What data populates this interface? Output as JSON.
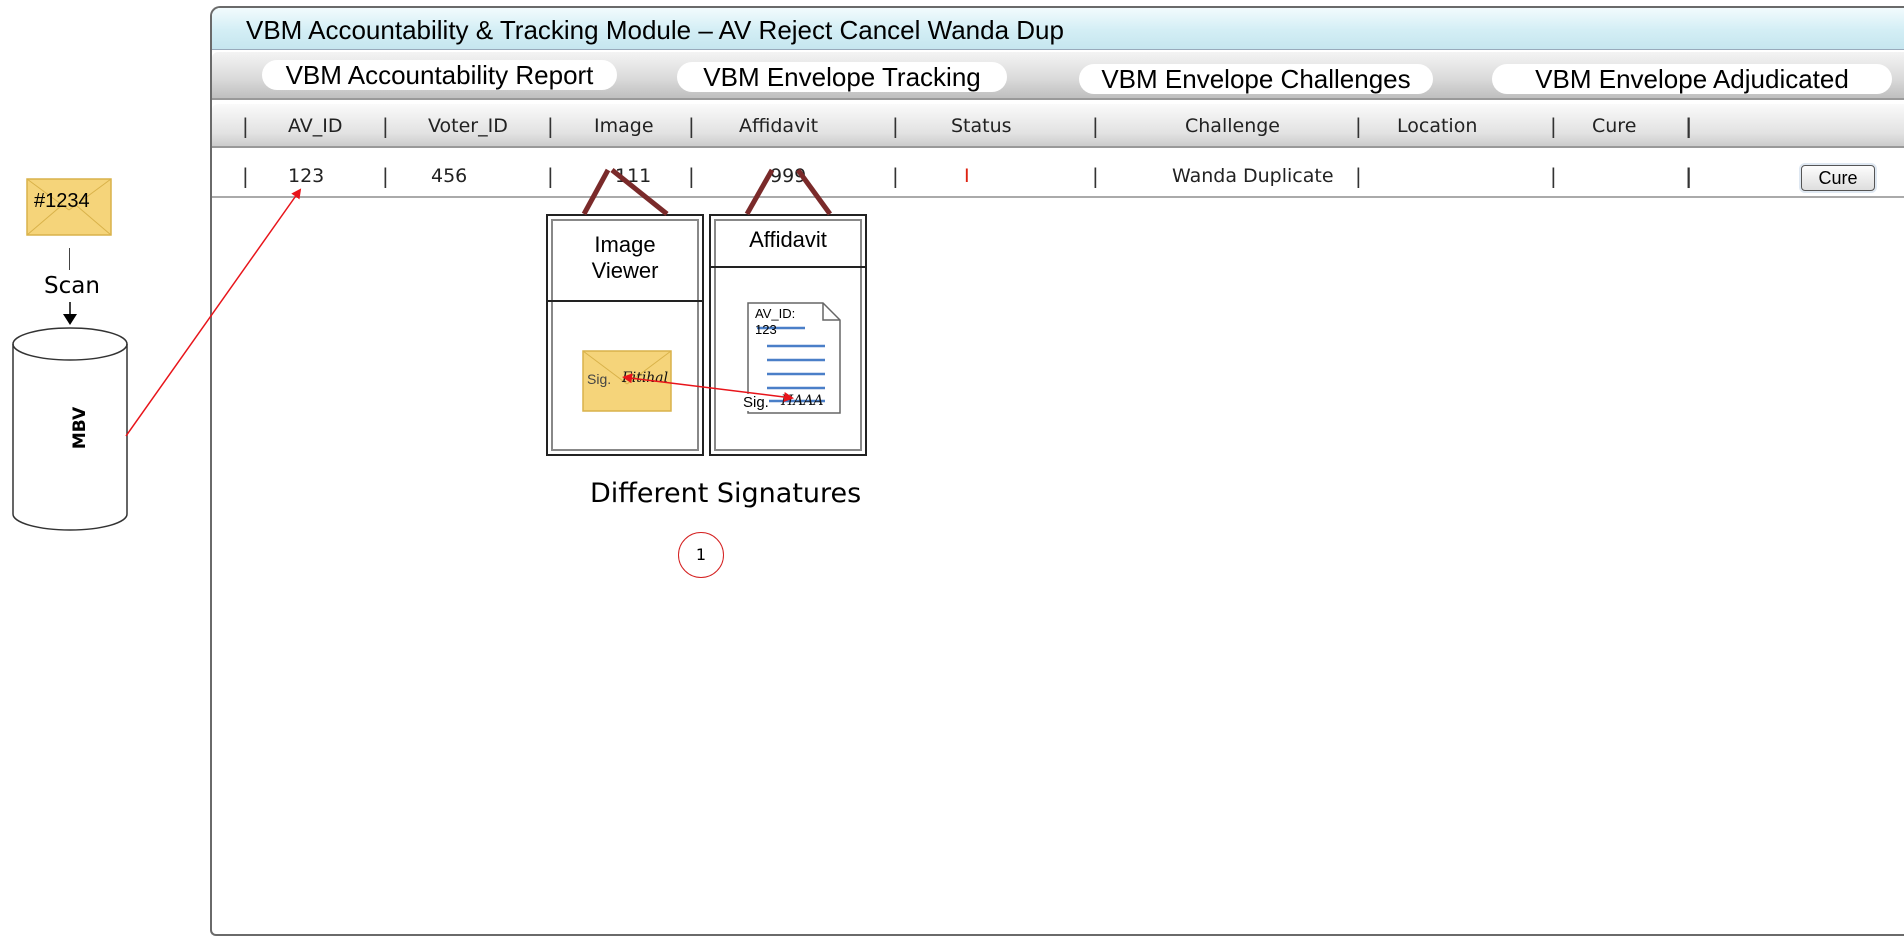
{
  "window": {
    "title": "VBM Accountability & Tracking Module – AV Reject Cancel Wanda Dup"
  },
  "tabs": [
    {
      "label": "VBM Accountability Report"
    },
    {
      "label": "VBM Envelope Tracking"
    },
    {
      "label": "VBM Envelope Challenges"
    },
    {
      "label": "VBM Envelope Adjudicated"
    }
  ],
  "table": {
    "columns": [
      "AV_ID",
      "Voter_ID",
      "Image",
      "Affidavit",
      "Status",
      "Challenge",
      "Location",
      "Cure"
    ],
    "row": {
      "av_id": "123",
      "voter_id": "456",
      "image": "111",
      "affidavit": "999",
      "status": "I",
      "challenge": "Wanda Duplicate",
      "location": "",
      "cure_button": "Cure"
    },
    "separator": "|"
  },
  "envelope": {
    "label": "#1234"
  },
  "scan": {
    "label": "Scan"
  },
  "database": {
    "label": "MBV"
  },
  "image_viewer": {
    "title_line1": "Image",
    "title_line2": "Viewer",
    "sig_prefix": "Sig.",
    "signature": "Fitihal"
  },
  "affidavit_viewer": {
    "title": "Affidavit",
    "doc_line1": "AV_ID:",
    "doc_line2": "123",
    "sig_prefix": "Sig.",
    "signature": "HAAA"
  },
  "annotation": {
    "text": "Different Signatures",
    "step_number": "1"
  },
  "colors": {
    "arrow": "#e8141a",
    "envelope_fill": "#f5d47a",
    "title_bar": "#d3eef5",
    "doc_lines": "#4a7fc8"
  }
}
